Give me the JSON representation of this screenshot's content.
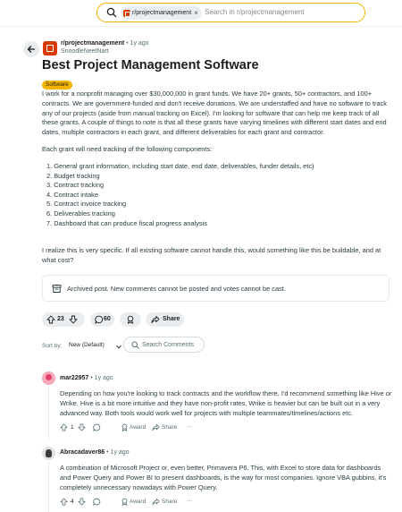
{
  "search": {
    "community_chip": "r/projectmanagement",
    "placeholder": "Search in r/projectmanagement"
  },
  "post": {
    "subreddit": "r/projectmanagement",
    "time": "1y ago",
    "author": "SnoodleNeetNart",
    "title": "Best Project Management Software",
    "flair": "Software",
    "paragraph_1": "I work for a nonprofit managing over $30,000,000 in grant funds. We have 20+ grants, 50+ contractors, and 100+ contracts. We are government-funded and don't receive donations. We are understaffed and have no software to track any of our projects (aside from manual tracking on Excel). I'm looking for software that can help me keep track of all these grants. A couple of things to note is that all these grants have varying timelines with different start dates and end dates, multiple contractors in each grant, and different deliverables for each grant and contractor.",
    "paragraph_2": "Each grant will need tracking of the following components:",
    "requirements": [
      "1. General grant information, including start date, end date, deliverables, funder details, etc)",
      "2. Budget tracking",
      "3. Contract tracking",
      "4. Contract intake",
      "5. Contract invoice tracking",
      "6. Deliverables tracking",
      "7. Dashboard that can produce fiscal progress analysis"
    ],
    "paragraph_3": "I realize this is very specific. If all existing software cannot handle this, would something like this be buildable, and at what cost?",
    "archived_notice": "Archived post. New comments cannot be posted and votes cannot be cast.",
    "score": "23",
    "comment_count": "60",
    "share_label": "Share"
  },
  "sort": {
    "label": "Sort by:",
    "value": "New (Default)"
  },
  "search_comments": {
    "label": "Search Comments"
  },
  "comments": [
    {
      "author": "mar22957",
      "time": "1y ago",
      "text": "Depending on how you're looking to track contracts and the workflow there, I'd recommend something like Hive or Wrike. Hive is a bit more intuitive and they have non-profit rates, Wrike is heavier but can be built out in a very advanced way. Both tools would work well for projects with multiple teammates/timelines/actions etc.",
      "score": "1",
      "award_label": "Award",
      "share_label": "Share",
      "more": "…"
    },
    {
      "author": "Abracadaver86",
      "time": "1y ago",
      "text": "A combination of Microsoft Project or, even better, Primavera P6. This, with Excel to store data for dashboards and Power Query and Power BI to present dashboards, is the way for most companies. Ignore VBA gubbins, it's completely unnecessary nowadays with Power Query.",
      "score": "4",
      "award_label": "Award",
      "share_label": "Share",
      "more": "…"
    }
  ],
  "dot": "•"
}
